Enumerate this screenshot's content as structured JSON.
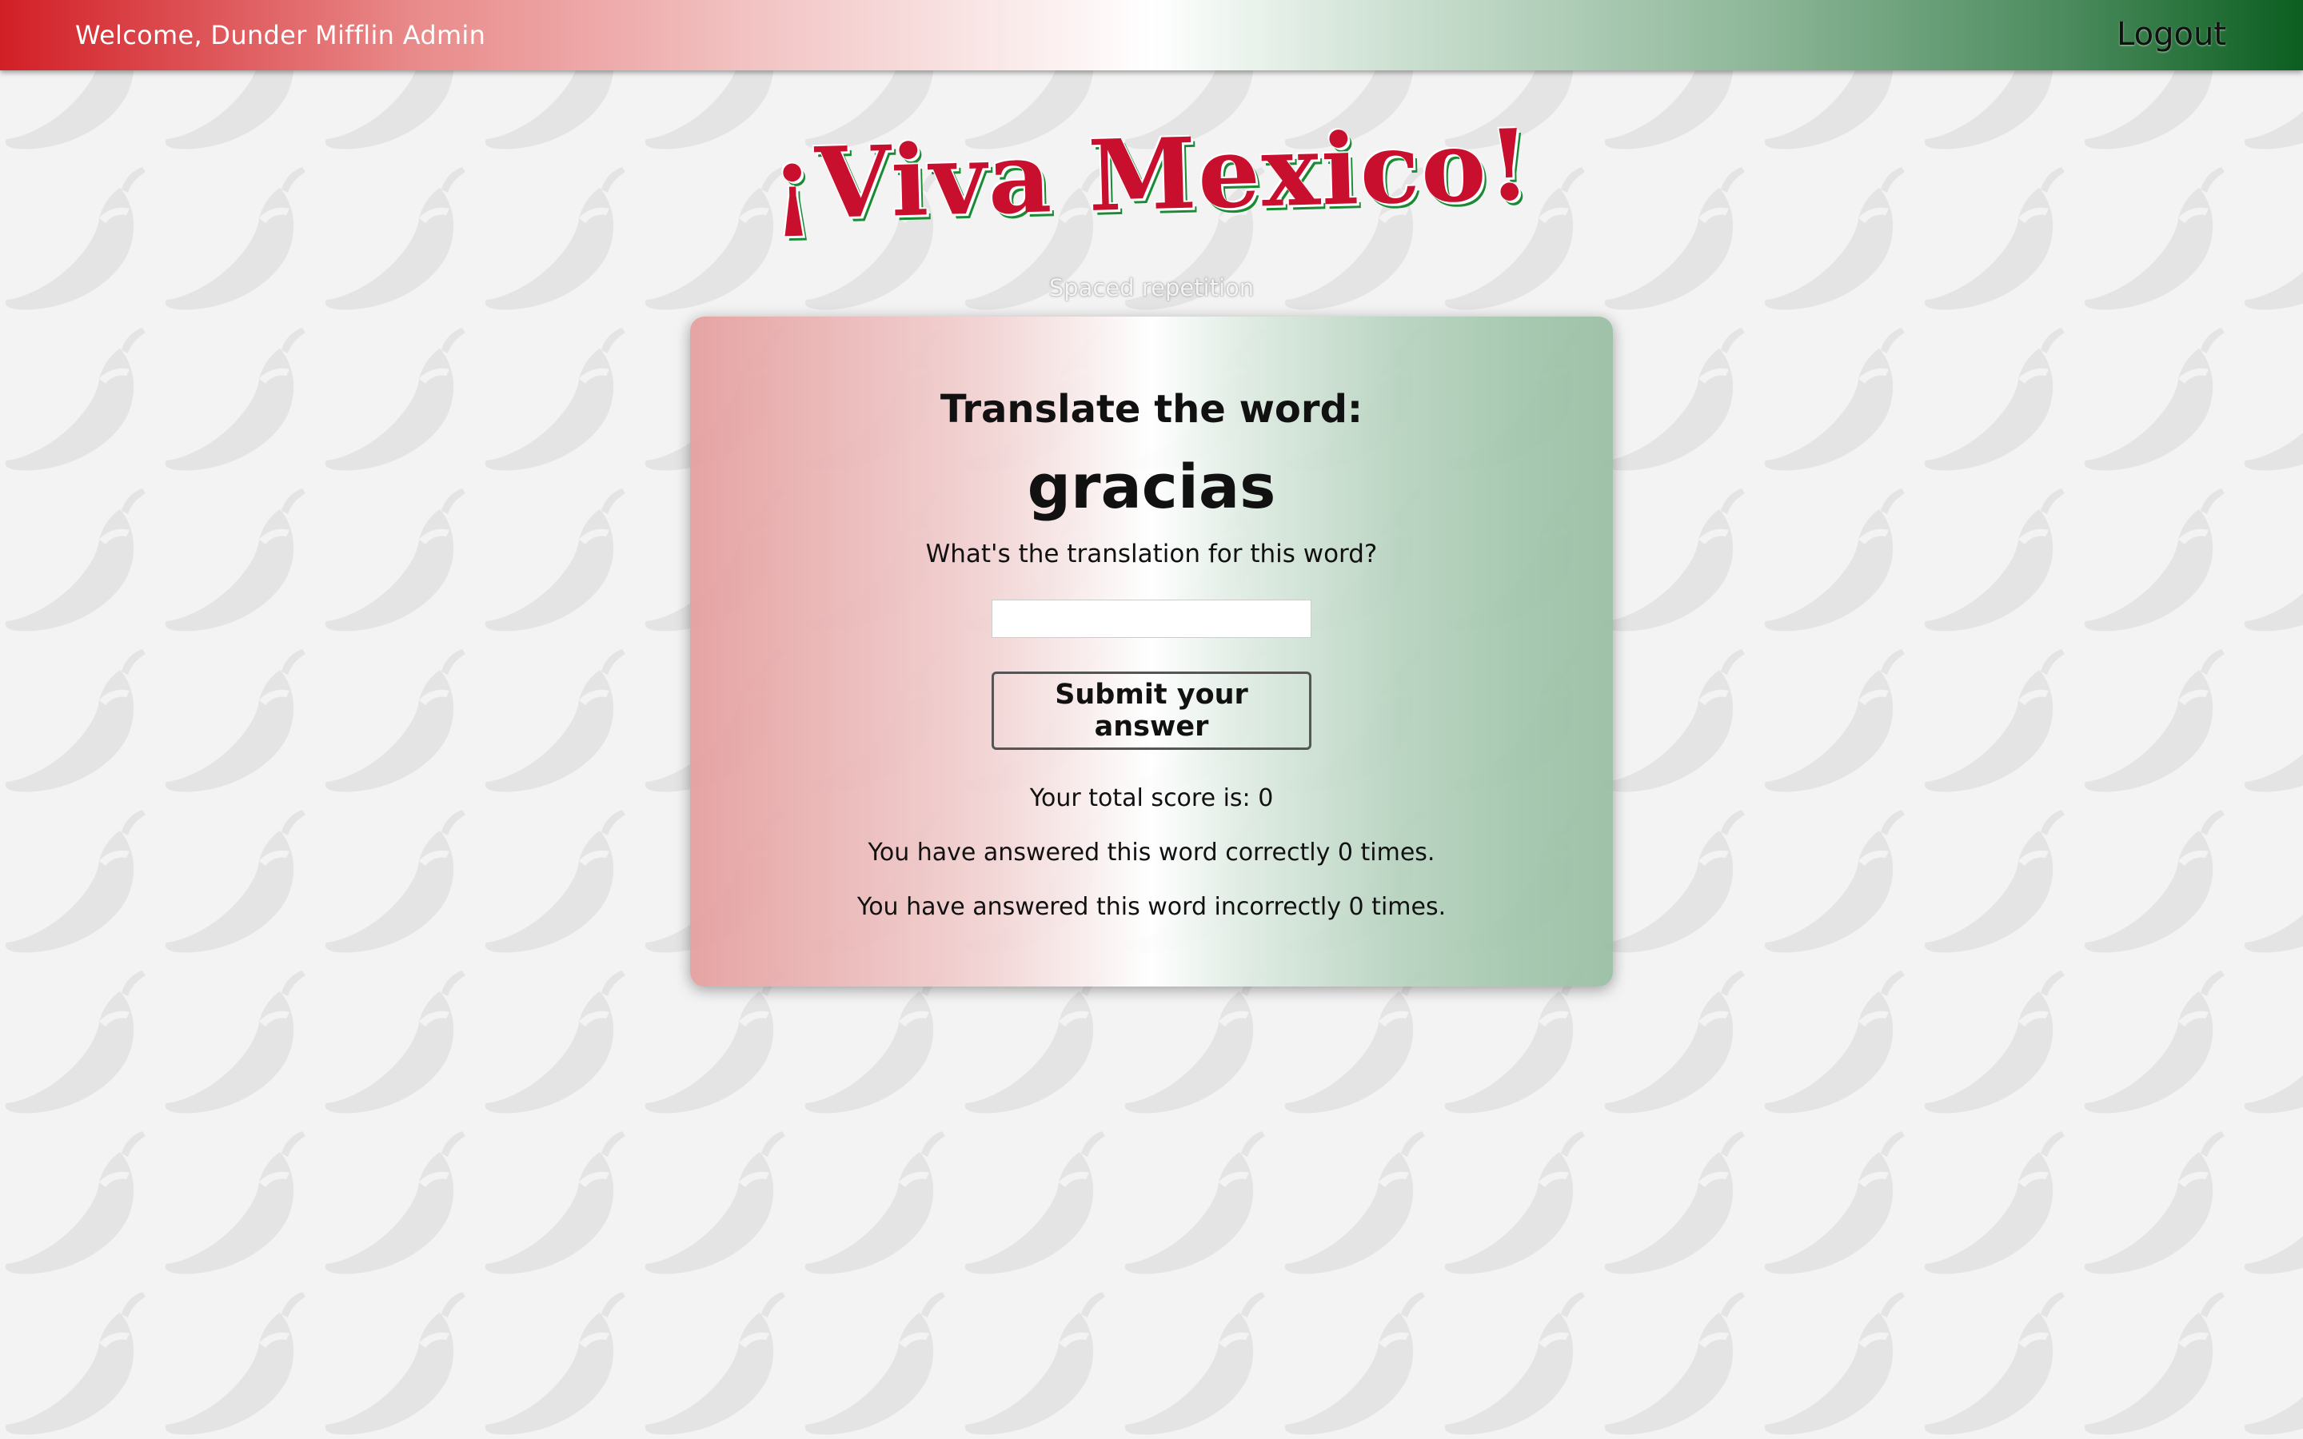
{
  "header": {
    "welcome_text": "Welcome, Dunder Mifflin Admin",
    "logout_label": "Logout"
  },
  "branding": {
    "logo_text": "¡Viva Mexico!",
    "subtitle": "Spaced repetition"
  },
  "colors": {
    "mexico_red": "#d21f26",
    "mexico_green": "#0b5e20",
    "logo_red": "#c8102e",
    "background": "#f3f3f3",
    "pattern_pepper": "#e3e3e3"
  },
  "background_pattern": {
    "icon": "chili-pepper-icon"
  },
  "card": {
    "prompt": "Translate the word:",
    "word": "gracias",
    "question": "What's the translation for this word?",
    "answer_input": {
      "value": "",
      "placeholder": ""
    },
    "submit_label": "Submit your answer",
    "total_score_text": "Your total score is: 0",
    "correct_text": "You have answered this word correctly 0 times.",
    "incorrect_text": "You have answered this word incorrectly 0 times."
  }
}
